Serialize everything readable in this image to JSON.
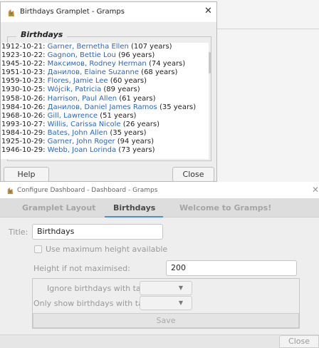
{
  "gramplet_window": {
    "title": "Birthdays Gramplet - Gramps",
    "close_glyph": "✕",
    "section_title": "Birthdays",
    "entries": [
      {
        "date": "1912-10-21:",
        "name": "Garner, Bernetha Ellen",
        "age": "(107 years)"
      },
      {
        "date": "1923-10-22:",
        "name": "Gagnon, Bettie Lou",
        "age": "(96 years)"
      },
      {
        "date": "1945-10-22:",
        "name": "Максимов, Rodney Herman",
        "age": "(74 years)"
      },
      {
        "date": "1951-10-23:",
        "name": "Данилов, Elaine Suzanne",
        "age": "(68 years)"
      },
      {
        "date": "1959-10-23:",
        "name": "Flores, Jamie Lee",
        "age": "(60 years)"
      },
      {
        "date": "1930-10-25:",
        "name": "Wójcik, Patricia",
        "age": "(89 years)"
      },
      {
        "date": "1958-10-26:",
        "name": "Harrison, Paul Allen",
        "age": "(61 years)"
      },
      {
        "date": "1984-10-26:",
        "name": "Данилов, Daniel James Ramos",
        "age": "(35 years)"
      },
      {
        "date": "1968-10-26:",
        "name": "Gill, Lawrence",
        "age": "(51 years)"
      },
      {
        "date": "1993-10-27:",
        "name": "Willis, Carissa Nicole",
        "age": "(26 years)"
      },
      {
        "date": "1984-10-29:",
        "name": "Bates, John Allen",
        "age": "(35 years)"
      },
      {
        "date": "1925-10-29:",
        "name": "Garner, John Roger",
        "age": "(94 years)"
      },
      {
        "date": "1946-10-29:",
        "name": "Webb, Joan Lorinda",
        "age": "(73 years)"
      }
    ],
    "help_label": "Help",
    "close_label": "Close"
  },
  "configure_dialog": {
    "title": "Configure Dashboard - Dashboard - Gramps",
    "close_glyph": "✕",
    "tabs": [
      {
        "label": "Gramplet Layout",
        "active": false
      },
      {
        "label": "Birthdays",
        "active": true
      },
      {
        "label": "Welcome to Gramps!",
        "active": false
      }
    ],
    "title_label": "Title:",
    "title_value": "Birthdays",
    "max_height_label": "Use maximum height available",
    "max_height_checked": false,
    "height_label": "Height if not maximised:",
    "height_value": "200",
    "ignore_tag_label": "Ignore birthdays with tag:",
    "ignore_tag_value": "",
    "only_tag_label": "Only show birthdays with tag:",
    "only_tag_value": "",
    "save_label": "Save",
    "close_label": "Close"
  },
  "colors": {
    "link": "#2a66c4",
    "tab_active_underline": "#4a8fd8"
  }
}
